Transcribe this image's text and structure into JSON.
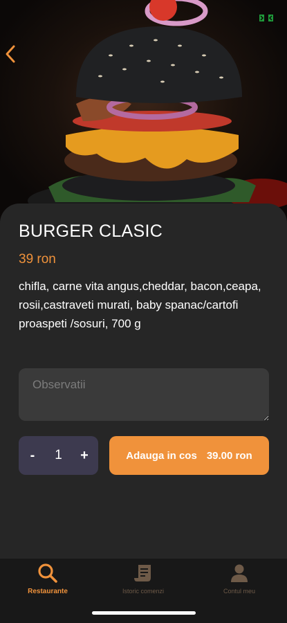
{
  "product": {
    "title": "BURGER CLASIC",
    "price": "39 ron",
    "description": "chifla, carne vita angus,cheddar, bacon,ceapa, rosii,castraveti murati, baby spanac/cartofi proaspeti /sosuri, 700 g"
  },
  "notes": {
    "placeholder": "Observatii"
  },
  "quantity": {
    "minus": "-",
    "value": "1",
    "plus": "+"
  },
  "add_to_cart": {
    "label": "Adauga in cos",
    "price": "39.00 ron"
  },
  "tabs": [
    {
      "label": "Restaurante",
      "icon": "search-icon",
      "active": true
    },
    {
      "label": "Istoric comenzi",
      "icon": "receipt-icon",
      "active": false
    },
    {
      "label": "Contul meu",
      "icon": "user-icon",
      "active": false
    }
  ],
  "colors": {
    "accent": "#f0923b",
    "sheet": "#262626",
    "stepper": "#3d3a4f",
    "inactive_tab": "#6e5a48"
  },
  "icons": {
    "back": "chevron-left-icon",
    "fullscreen": "fullscreen-icon"
  }
}
